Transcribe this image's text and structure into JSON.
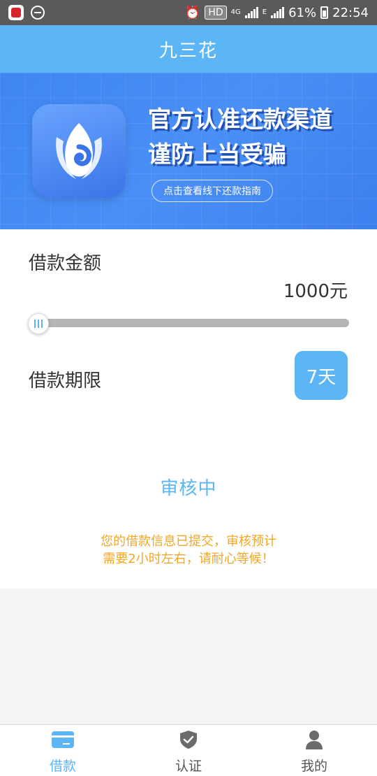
{
  "status_bar": {
    "hd": "HD",
    "network": "4G",
    "network_e": "E",
    "battery": "61%",
    "time": "22:54"
  },
  "header": {
    "title": "九三花"
  },
  "banner": {
    "headline_line1": "官方认准还款渠道",
    "headline_line2": "谨防上当受骗",
    "guide_button": "点击查看线下还款指南"
  },
  "loan": {
    "amount_label": "借款金额",
    "amount_value": "1000元",
    "amount_fraction": 0.0,
    "term_label": "借款期限",
    "term_value": "7天"
  },
  "review": {
    "status": "审核中",
    "message_line1": "您的借款信息已提交，审核预计",
    "message_line2": "需要2小时左右，请耐心等候！"
  },
  "tabs": [
    {
      "label": "借款",
      "icon": "card-icon",
      "active": true
    },
    {
      "label": "认证",
      "icon": "shield-check-icon",
      "active": false
    },
    {
      "label": "我的",
      "icon": "person-icon",
      "active": false
    }
  ],
  "colors": {
    "accent": "#5cb6f6",
    "warning_text": "#f5a623",
    "banner_blue": "#4a8ff6"
  }
}
